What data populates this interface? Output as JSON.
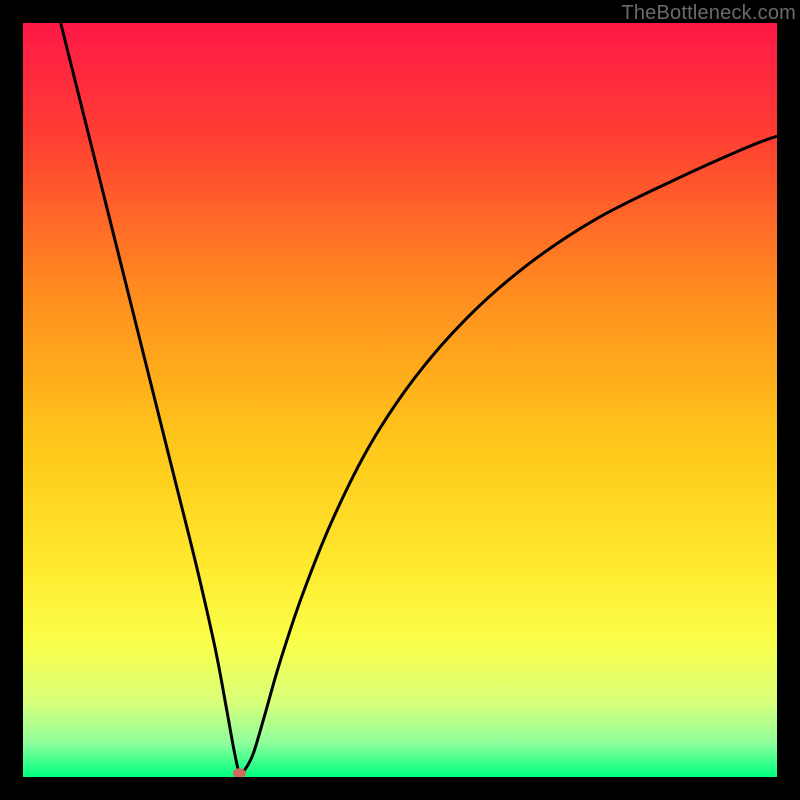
{
  "watermark": "TheBottleneck.com",
  "chart_data": {
    "type": "line",
    "title": "",
    "xlabel": "",
    "ylabel": "",
    "xlim": [
      0,
      100
    ],
    "ylim": [
      0,
      100
    ],
    "gradient_stops": [
      {
        "offset": 0.0,
        "color": "#ff1846"
      },
      {
        "offset": 0.15,
        "color": "#ff3e33"
      },
      {
        "offset": 0.35,
        "color": "#ff8a1f"
      },
      {
        "offset": 0.55,
        "color": "#ffc51a"
      },
      {
        "offset": 0.72,
        "color": "#ffe92e"
      },
      {
        "offset": 0.82,
        "color": "#fbff4a"
      },
      {
        "offset": 0.9,
        "color": "#d9ff7a"
      },
      {
        "offset": 0.955,
        "color": "#8eff9c"
      },
      {
        "offset": 1.0,
        "color": "#00ff80"
      }
    ],
    "series": [
      {
        "name": "bottleneck-curve",
        "x": [
          5,
          8,
          11,
          14,
          17,
          20,
          23,
          25.5,
          27,
          28,
          28.7,
          29.3,
          30.5,
          32,
          34,
          37,
          41,
          46,
          52,
          59,
          67,
          76,
          86,
          96,
          100
        ],
        "y": [
          100,
          88,
          76,
          64,
          52,
          40,
          28,
          17,
          9,
          3.5,
          0.5,
          0.8,
          3,
          8,
          15,
          24,
          34,
          44,
          53,
          61,
          68,
          74,
          79,
          83.5,
          85
        ]
      }
    ],
    "marker": {
      "x": 28.7,
      "y": 0.5,
      "color": "#d06a5a"
    }
  }
}
